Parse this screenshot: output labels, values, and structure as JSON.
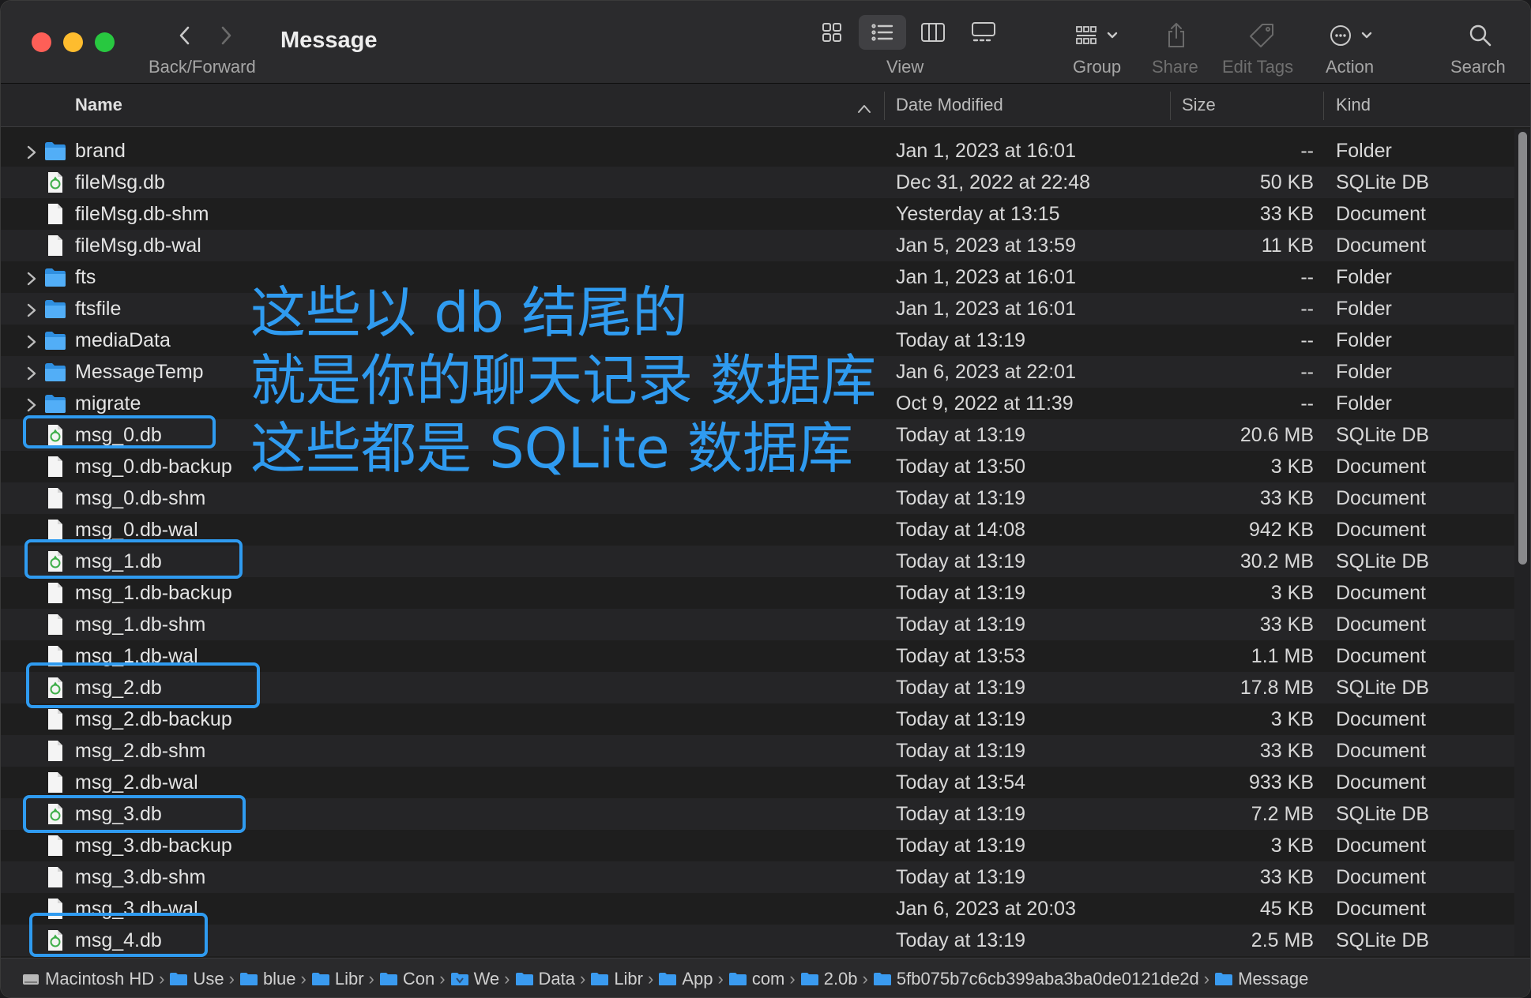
{
  "window": {
    "title": "Message"
  },
  "toolbar": {
    "back_forward_label": "Back/Forward",
    "view_label": "View",
    "group_label": "Group",
    "share_label": "Share",
    "edit_tags_label": "Edit Tags",
    "action_label": "Action",
    "search_label": "Search",
    "active_view": "list"
  },
  "columns": {
    "name": "Name",
    "date": "Date Modified",
    "size": "Size",
    "kind": "Kind"
  },
  "files": [
    {
      "name": "brand",
      "date": "Jan 1, 2023 at 16:01",
      "size": "--",
      "kind": "Folder",
      "icon": "folder-icon"
    },
    {
      "name": "fileMsg.db",
      "date": "Dec 31, 2022 at 22:48",
      "size": "50 KB",
      "kind": "SQLite DB",
      "icon": "sqlite-icon"
    },
    {
      "name": "fileMsg.db-shm",
      "date": "Yesterday at 13:15",
      "size": "33 KB",
      "kind": "Document",
      "icon": "document-icon"
    },
    {
      "name": "fileMsg.db-wal",
      "date": "Jan 5, 2023 at 13:59",
      "size": "11 KB",
      "kind": "Document",
      "icon": "document-icon"
    },
    {
      "name": "fts",
      "date": "Jan 1, 2023 at 16:01",
      "size": "--",
      "kind": "Folder",
      "icon": "folder-icon"
    },
    {
      "name": "ftsfile",
      "date": "Jan 1, 2023 at 16:01",
      "size": "--",
      "kind": "Folder",
      "icon": "folder-icon"
    },
    {
      "name": "mediaData",
      "date": "Today at 13:19",
      "size": "--",
      "kind": "Folder",
      "icon": "folder-icon"
    },
    {
      "name": "MessageTemp",
      "date": "Jan 6, 2023 at 22:01",
      "size": "--",
      "kind": "Folder",
      "icon": "folder-icon"
    },
    {
      "name": "migrate",
      "date": "Oct 9, 2022 at 11:39",
      "size": "--",
      "kind": "Folder",
      "icon": "folder-icon"
    },
    {
      "name": "msg_0.db",
      "date": "Today at 13:19",
      "size": "20.6 MB",
      "kind": "SQLite DB",
      "icon": "sqlite-icon"
    },
    {
      "name": "msg_0.db-backup",
      "date": "Today at 13:50",
      "size": "3 KB",
      "kind": "Document",
      "icon": "document-icon"
    },
    {
      "name": "msg_0.db-shm",
      "date": "Today at 13:19",
      "size": "33 KB",
      "kind": "Document",
      "icon": "document-icon"
    },
    {
      "name": "msg_0.db-wal",
      "date": "Today at 14:08",
      "size": "942 KB",
      "kind": "Document",
      "icon": "document-icon"
    },
    {
      "name": "msg_1.db",
      "date": "Today at 13:19",
      "size": "30.2 MB",
      "kind": "SQLite DB",
      "icon": "sqlite-icon"
    },
    {
      "name": "msg_1.db-backup",
      "date": "Today at 13:19",
      "size": "3 KB",
      "kind": "Document",
      "icon": "document-icon"
    },
    {
      "name": "msg_1.db-shm",
      "date": "Today at 13:19",
      "size": "33 KB",
      "kind": "Document",
      "icon": "document-icon"
    },
    {
      "name": "msg_1.db-wal",
      "date": "Today at 13:53",
      "size": "1.1 MB",
      "kind": "Document",
      "icon": "document-icon"
    },
    {
      "name": "msg_2.db",
      "date": "Today at 13:19",
      "size": "17.8 MB",
      "kind": "SQLite DB",
      "icon": "sqlite-icon"
    },
    {
      "name": "msg_2.db-backup",
      "date": "Today at 13:19",
      "size": "3 KB",
      "kind": "Document",
      "icon": "document-icon"
    },
    {
      "name": "msg_2.db-shm",
      "date": "Today at 13:19",
      "size": "33 KB",
      "kind": "Document",
      "icon": "document-icon"
    },
    {
      "name": "msg_2.db-wal",
      "date": "Today at 13:54",
      "size": "933 KB",
      "kind": "Document",
      "icon": "document-icon"
    },
    {
      "name": "msg_3.db",
      "date": "Today at 13:19",
      "size": "7.2 MB",
      "kind": "SQLite DB",
      "icon": "sqlite-icon"
    },
    {
      "name": "msg_3.db-backup",
      "date": "Today at 13:19",
      "size": "3 KB",
      "kind": "Document",
      "icon": "document-icon"
    },
    {
      "name": "msg_3.db-shm",
      "date": "Today at 13:19",
      "size": "33 KB",
      "kind": "Document",
      "icon": "document-icon"
    },
    {
      "name": "msg_3.db-wal",
      "date": "Jan 6, 2023 at 20:03",
      "size": "45 KB",
      "kind": "Document",
      "icon": "document-icon"
    },
    {
      "name": "msg_4.db",
      "date": "Today at 13:19",
      "size": "2.5 MB",
      "kind": "SQLite DB",
      "icon": "sqlite-icon"
    }
  ],
  "annotation": {
    "line1": "这些以 db 结尾的",
    "line2": "就是你的聊天记录 数据库",
    "line3": "这些都是 SQLite 数据库",
    "color": "#2f9bf0"
  },
  "path_bar": [
    {
      "label": "Macintosh HD",
      "icon": "disk-icon"
    },
    {
      "label": "Use",
      "icon": "users-folder-icon"
    },
    {
      "label": "blue",
      "icon": "home-folder-icon"
    },
    {
      "label": "Libr",
      "icon": "folder-icon"
    },
    {
      "label": "Con",
      "icon": "folder-icon"
    },
    {
      "label": "We",
      "icon": "app-folder-icon"
    },
    {
      "label": "Data",
      "icon": "folder-icon"
    },
    {
      "label": "Libr",
      "icon": "folder-icon"
    },
    {
      "label": "App",
      "icon": "folder-icon"
    },
    {
      "label": "com",
      "icon": "folder-icon"
    },
    {
      "label": "2.0b",
      "icon": "folder-icon"
    },
    {
      "label": "5fb075b7c6cb399aba3ba0de0121de2d",
      "icon": "folder-icon"
    },
    {
      "label": "Message",
      "icon": "folder-icon"
    }
  ],
  "colors": {
    "folder": "#3aa2f3",
    "sqlite": "#4caf50",
    "accent": "#2f9bf0"
  }
}
